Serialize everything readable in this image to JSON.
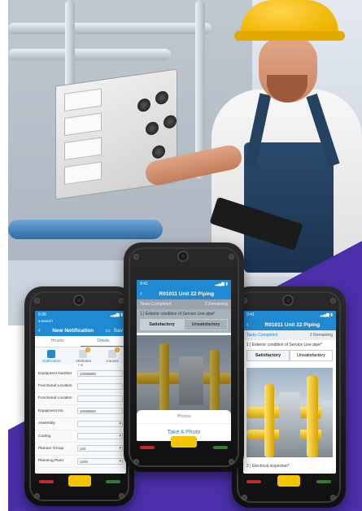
{
  "left_phone": {
    "status_time": "8:36",
    "status_sub": "◂ Search",
    "title": "New Notification",
    "save_label": "Sav",
    "tabs": [
      "Header",
      "Details"
    ],
    "steps": [
      {
        "label": "Notification",
        "badge": ""
      },
      {
        "label": "Attributes",
        "badge": "1"
      },
      {
        "label": "Causes",
        "badge": "1"
      }
    ],
    "fields": [
      {
        "label": "Equipment Number",
        "value": "10008860"
      },
      {
        "label": "Functional Location",
        "value": ""
      },
      {
        "label": "Functional Location",
        "value": ""
      },
      {
        "label": "Equipment No.",
        "value": "10008860"
      },
      {
        "label": "Assembly",
        "value": ""
      },
      {
        "label": "Coding",
        "value": ""
      },
      {
        "label": "Planner Group",
        "value": "100"
      },
      {
        "label": "Planning Plant",
        "value": "1000"
      }
    ]
  },
  "center_phone": {
    "status_time": "9:41",
    "title": "R01011 Unit 22 Piping",
    "subbar_left": "Tasks Completed",
    "subbar_right": "2 Remaining",
    "question": "1 | Exterior condition of Service Line pipe*",
    "choice_1": "Satisfactory",
    "choice_2": "Unsatisfactory",
    "sheet_title": "Photos",
    "sheet_action": "Take A Photo"
  },
  "right_phone": {
    "status_time": "9:41",
    "title": "R01011 Unit 22 Piping",
    "subbar_left": "Tasks Completed",
    "subbar_right": "2 Remaining",
    "question": "1 | Exterior condition of Service Line pipe*",
    "choice_1": "Satisfactory",
    "choice_2": "Unsatisfactory",
    "footer_question": "2 | Electrical inspection*"
  },
  "colors": {
    "brand_purple": "#4a2fa8",
    "app_blue": "#1f8ad1",
    "hardhat_yellow": "#f5c400"
  }
}
